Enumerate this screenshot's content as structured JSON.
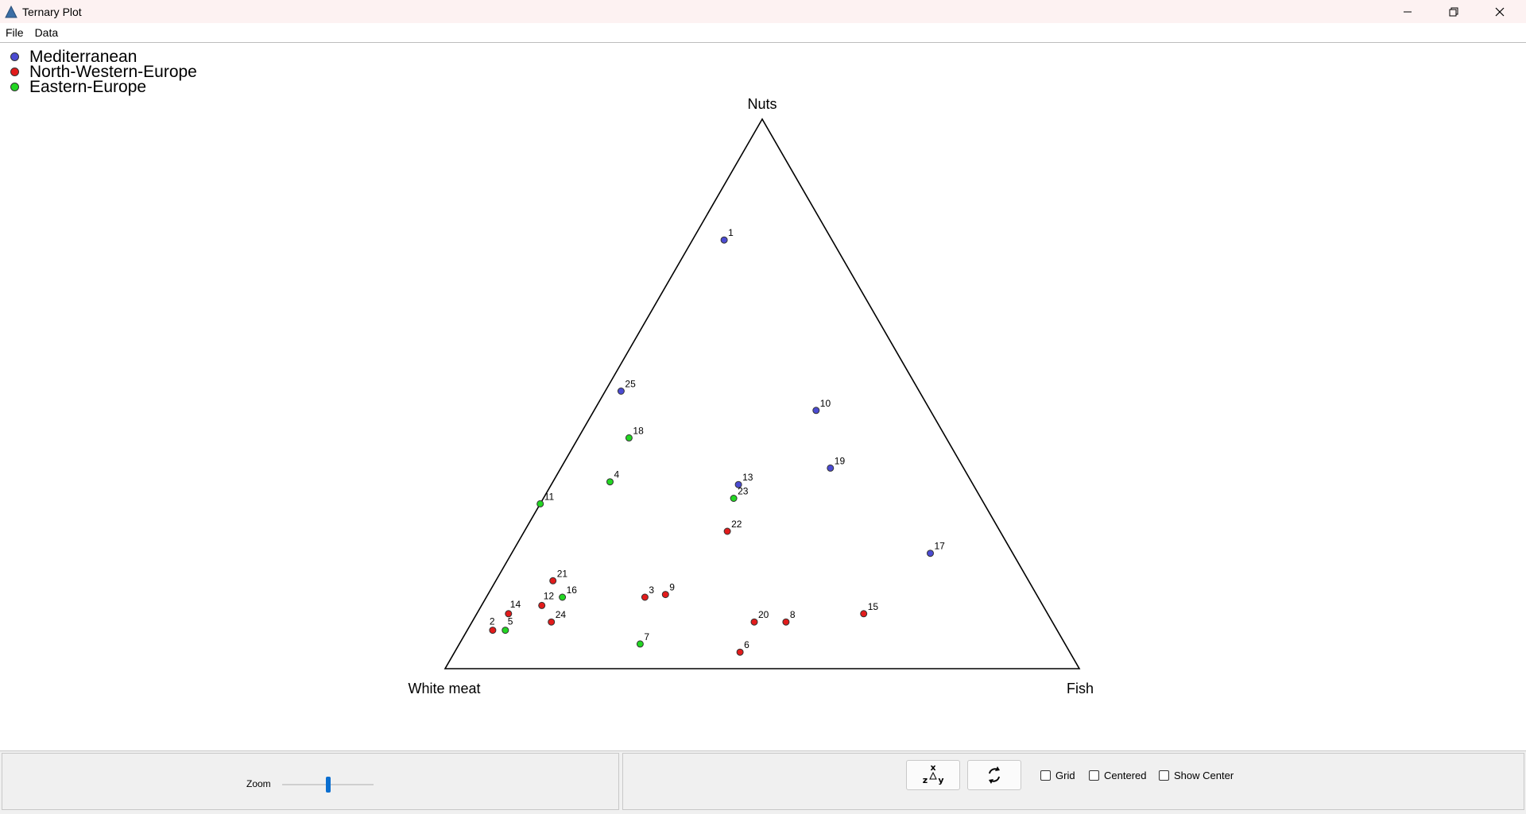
{
  "window": {
    "title": "Ternary Plot",
    "icon": "triangle-icon",
    "controls": [
      "minimize-icon",
      "restore-icon",
      "close-icon"
    ]
  },
  "menu": {
    "items": [
      "File",
      "Data"
    ]
  },
  "legend": [
    {
      "label": "Mediterranean",
      "color": "#4b4bd2"
    },
    {
      "label": "North-Western-Europe",
      "color": "#e21b1b"
    },
    {
      "label": "Eastern-Europe",
      "color": "#22d622"
    }
  ],
  "chart_data": {
    "type": "scatter",
    "subtype": "ternary",
    "axes": {
      "top": "Nuts",
      "left": "White meat",
      "right": "Fish"
    },
    "grid": false,
    "legend_position": "top-left",
    "points": [
      {
        "label": "1",
        "group": "Mediterranean",
        "nuts": 0.78,
        "white_meat": 0.17,
        "fish": 0.05
      },
      {
        "label": "2",
        "group": "North-Western-Europe",
        "nuts": 0.07,
        "white_meat": 0.89,
        "fish": 0.04
      },
      {
        "label": "3",
        "group": "North-Western-Europe",
        "nuts": 0.13,
        "white_meat": 0.62,
        "fish": 0.25
      },
      {
        "label": "4",
        "group": "Eastern-Europe",
        "nuts": 0.34,
        "white_meat": 0.57,
        "fish": 0.09
      },
      {
        "label": "5",
        "group": "Eastern-Europe",
        "nuts": 0.07,
        "white_meat": 0.87,
        "fish": 0.06
      },
      {
        "label": "6",
        "group": "North-Western-Europe",
        "nuts": 0.03,
        "white_meat": 0.52,
        "fish": 0.45
      },
      {
        "label": "7",
        "group": "Eastern-Europe",
        "nuts": 0.045,
        "white_meat": 0.67,
        "fish": 0.285
      },
      {
        "label": "8",
        "group": "North-Western-Europe",
        "nuts": 0.085,
        "white_meat": 0.42,
        "fish": 0.495
      },
      {
        "label": "9",
        "group": "North-Western-Europe",
        "nuts": 0.135,
        "white_meat": 0.585,
        "fish": 0.28
      },
      {
        "label": "10",
        "group": "Mediterranean",
        "nuts": 0.47,
        "white_meat": 0.18,
        "fish": 0.35
      },
      {
        "label": "11",
        "group": "Eastern-Europe",
        "nuts": 0.3,
        "white_meat": 0.7,
        "fish": 0.0
      },
      {
        "label": "12",
        "group": "North-Western-Europe",
        "nuts": 0.115,
        "white_meat": 0.79,
        "fish": 0.095
      },
      {
        "label": "13",
        "group": "Mediterranean",
        "nuts": 0.335,
        "white_meat": 0.37,
        "fish": 0.295
      },
      {
        "label": "14",
        "group": "North-Western-Europe",
        "nuts": 0.1,
        "white_meat": 0.85,
        "fish": 0.05
      },
      {
        "label": "15",
        "group": "North-Western-Europe",
        "nuts": 0.1,
        "white_meat": 0.29,
        "fish": 0.61
      },
      {
        "label": "16",
        "group": "Eastern-Europe",
        "nuts": 0.13,
        "white_meat": 0.75,
        "fish": 0.12
      },
      {
        "label": "17",
        "group": "Mediterranean",
        "nuts": 0.21,
        "white_meat": 0.13,
        "fish": 0.66
      },
      {
        "label": "18",
        "group": "Eastern-Europe",
        "nuts": 0.42,
        "white_meat": 0.5,
        "fish": 0.08
      },
      {
        "label": "19",
        "group": "Mediterranean",
        "nuts": 0.365,
        "white_meat": 0.21,
        "fish": 0.425
      },
      {
        "label": "20",
        "group": "North-Western-Europe",
        "nuts": 0.085,
        "white_meat": 0.47,
        "fish": 0.445
      },
      {
        "label": "21",
        "group": "North-Western-Europe",
        "nuts": 0.16,
        "white_meat": 0.75,
        "fish": 0.09
      },
      {
        "label": "22",
        "group": "North-Western-Europe",
        "nuts": 0.25,
        "white_meat": 0.43,
        "fish": 0.32
      },
      {
        "label": "23",
        "group": "Eastern-Europe",
        "nuts": 0.31,
        "white_meat": 0.39,
        "fish": 0.3
      },
      {
        "label": "24",
        "group": "North-Western-Europe",
        "nuts": 0.085,
        "white_meat": 0.79,
        "fish": 0.125
      },
      {
        "label": "25",
        "group": "Mediterranean",
        "nuts": 0.505,
        "white_meat": 0.47,
        "fish": 0.025
      }
    ]
  },
  "bottom": {
    "zoom_label": "Zoom",
    "zoom_level": 0.5,
    "swap_axes_icon": "swap-axes-icon",
    "rotate_icon": "rotate-icon",
    "checkboxes": [
      {
        "label": "Grid",
        "checked": false
      },
      {
        "label": "Centered",
        "checked": false
      },
      {
        "label": "Show Center",
        "checked": false
      }
    ]
  }
}
